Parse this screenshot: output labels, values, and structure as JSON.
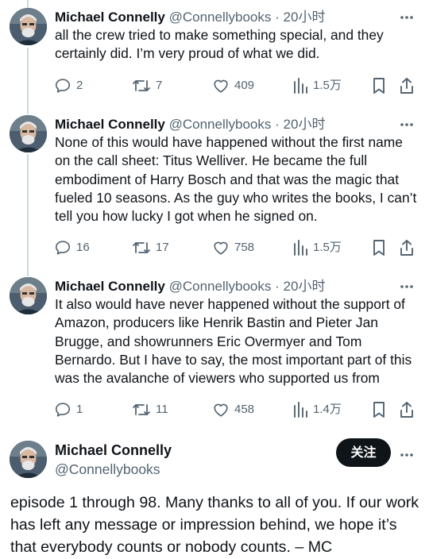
{
  "tweets": [
    {
      "name": "Michael Connelly",
      "handle": "@Connellybooks",
      "dot": "·",
      "time": "20小时",
      "text": "all the crew tried to make something special, and they certainly did. I’m very proud of what we did.",
      "replies": "2",
      "retweets": "7",
      "likes": "409",
      "views": "1.5万"
    },
    {
      "name": "Michael Connelly",
      "handle": "@Connellybooks",
      "dot": "·",
      "time": "20小时",
      "text": "None of this would have happened without the first name on the call sheet: Titus Welliver. He became the full embodiment of Harry Bosch and that was the magic that fueled 10 seasons. As the guy who writes the books, I can’t tell you how lucky I got when he signed on.",
      "replies": "16",
      "retweets": "17",
      "likes": "758",
      "views": "1.5万"
    },
    {
      "name": "Michael Connelly",
      "handle": "@Connellybooks",
      "dot": "·",
      "time": "20小时",
      "text": "It also would have never happened without the support of Amazon, producers like Henrik Bastin and Pieter Jan Brugge, and showrunners Eric Overmyer and Tom Bernardo. But I have to say, the most important part of this was the avalanche of viewers who supported us from",
      "replies": "1",
      "retweets": "11",
      "likes": "458",
      "views": "1.4万"
    }
  ],
  "focused": {
    "name": "Michael Connelly",
    "handle": "@Connellybooks",
    "follow_label": "关注",
    "text": "episode 1 through 98. Many thanks to all of you. If our work has left any message or impression behind, we hope it’s that everybody counts or nobody counts. – MC"
  },
  "icons": [
    "avatar",
    "more-icon",
    "reply-icon",
    "retweet-icon",
    "like-icon",
    "views-icon",
    "bookmark-icon",
    "share-icon"
  ],
  "colors": {
    "text": "#0f1419",
    "secondary": "#536471",
    "thread_line": "#cfd9de",
    "follow_bg": "#0f1419"
  }
}
